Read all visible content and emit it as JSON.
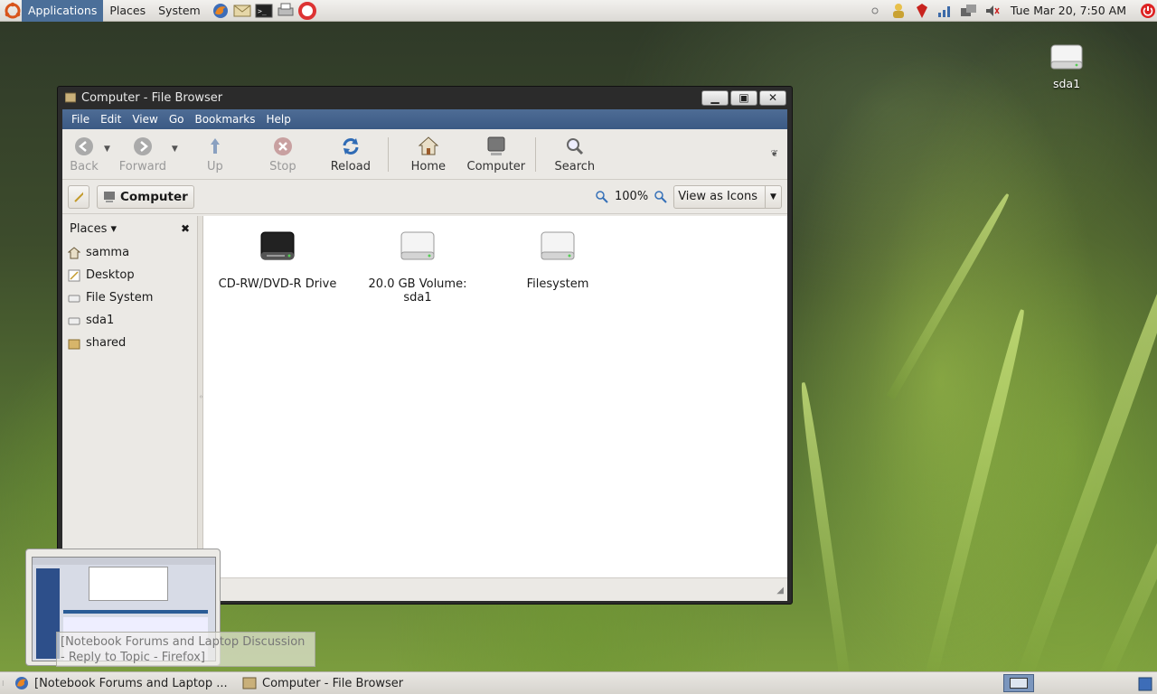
{
  "top_panel": {
    "menus": [
      "Applications",
      "Places",
      "System"
    ],
    "launchers": [
      "firefox-icon",
      "mail-icon",
      "terminal-icon",
      "printer-icon",
      "help-icon"
    ],
    "tray_icons": [
      "notification-icon",
      "user-icon",
      "ruby-icon",
      "network-signal-icon",
      "network-monitor-icon",
      "volume-muted-icon"
    ],
    "clock": "Tue Mar 20,  7:50 AM",
    "power_icon": "power-icon"
  },
  "desktop": {
    "icons": [
      {
        "label": "sda1",
        "icon": "drive-icon"
      }
    ]
  },
  "window": {
    "title": "Computer - File Browser",
    "menubar": [
      "File",
      "Edit",
      "View",
      "Go",
      "Bookmarks",
      "Help"
    ],
    "toolbar": {
      "back": "Back",
      "forward": "Forward",
      "up": "Up",
      "stop": "Stop",
      "reload": "Reload",
      "home": "Home",
      "computer": "Computer",
      "search": "Search"
    },
    "location": {
      "current": "Computer",
      "zoom": "100%",
      "view_mode": "View as Icons"
    },
    "sidebar": {
      "header": "Places",
      "items": [
        {
          "label": "samma",
          "icon": "home-icon"
        },
        {
          "label": "Desktop",
          "icon": "desktop-icon"
        },
        {
          "label": "File System",
          "icon": "drive-icon"
        },
        {
          "label": "sda1",
          "icon": "drive-icon"
        },
        {
          "label": "shared",
          "icon": "folder-icon"
        }
      ]
    },
    "files": [
      {
        "label": "CD-RW/DVD-R Drive",
        "icon": "optical-drive-icon"
      },
      {
        "label": "20.0 GB Volume: sda1",
        "icon": "drive-icon"
      },
      {
        "label": "Filesystem",
        "icon": "drive-icon"
      }
    ]
  },
  "taskbar": {
    "tasks": [
      {
        "label": "[Notebook Forums and Laptop ...",
        "icon": "firefox-icon"
      },
      {
        "label": "Computer - File Browser",
        "icon": "file-browser-icon"
      }
    ],
    "thumbnail_tooltip": "[Notebook Forums and Laptop Discussion - Reply to Topic - Firefox]"
  }
}
